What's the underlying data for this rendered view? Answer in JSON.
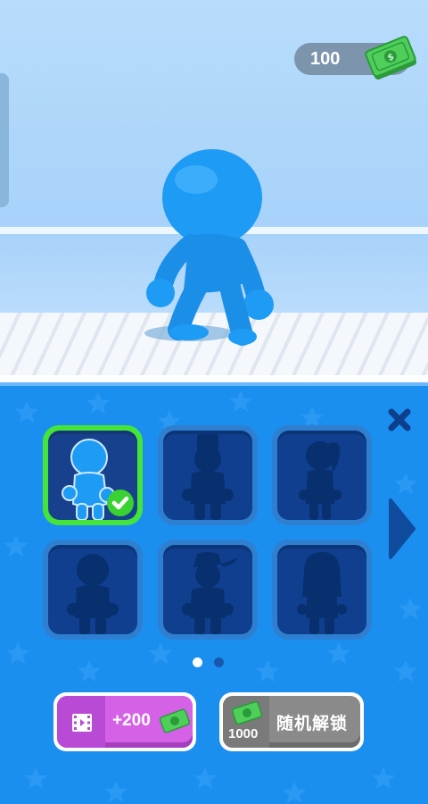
{
  "currency": {
    "value": "100",
    "icon": "cash-bill-icon"
  },
  "close_icon": "close-x-icon",
  "characters": [
    {
      "id": "basic",
      "state": "selected"
    },
    {
      "id": "tall-hat",
      "state": "locked"
    },
    {
      "id": "ponytail",
      "state": "locked"
    },
    {
      "id": "bun",
      "state": "locked"
    },
    {
      "id": "cowboy",
      "state": "locked"
    },
    {
      "id": "long-hair",
      "state": "locked"
    }
  ],
  "pagination": {
    "current": 1,
    "total": 2
  },
  "buttons": {
    "ad_reward": {
      "label": "+200",
      "icon": "video-icon",
      "color": "#d561e7"
    },
    "random_unlock": {
      "cost": "1000",
      "label": "随机解锁",
      "color": "#8a8a8a"
    }
  },
  "colors": {
    "panel": "#1b8ff0",
    "selected": "#44e43a",
    "character": "#1d9bf5"
  }
}
